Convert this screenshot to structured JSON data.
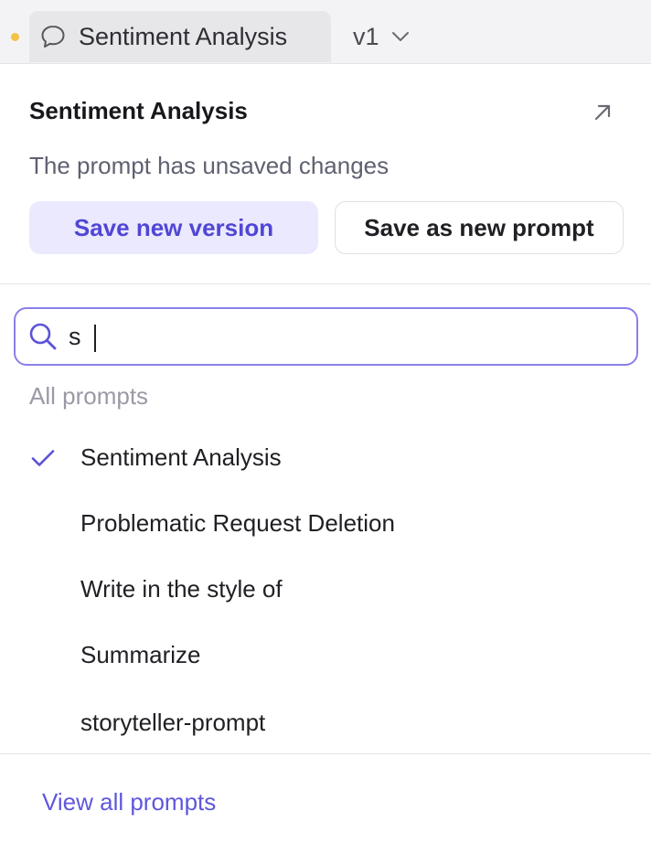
{
  "topbar": {
    "title": "Sentiment Analysis",
    "version": "v1",
    "icons": {
      "unsaved_dot": "unsaved-indicator-dot",
      "chat": "chat-bubble-icon",
      "chevron": "chevron-down-icon"
    },
    "colors": {
      "unsaved_dot": "#f5c242"
    }
  },
  "header": {
    "title": "Sentiment Analysis",
    "open_icon": "arrow-up-right-icon",
    "unsaved_message": "The prompt has unsaved changes",
    "save_new_version_label": "Save new version",
    "save_as_new_prompt_label": "Save as new prompt"
  },
  "search": {
    "value": "s",
    "icon": "search-icon"
  },
  "prompts": {
    "section_label": "All prompts",
    "items": [
      {
        "label": "Sentiment Analysis",
        "selected": true
      },
      {
        "label": "Problematic Request Deletion",
        "selected": false
      },
      {
        "label": "Write in the style of",
        "selected": false
      },
      {
        "label": "Summarize",
        "selected": false
      },
      {
        "label": "storyteller-prompt",
        "selected": false
      }
    ]
  },
  "footer": {
    "view_all_label": "View all prompts"
  },
  "colors": {
    "accent": "#5046d6",
    "accent_bg": "#ebe9fd",
    "search_border": "#8a80ea"
  }
}
